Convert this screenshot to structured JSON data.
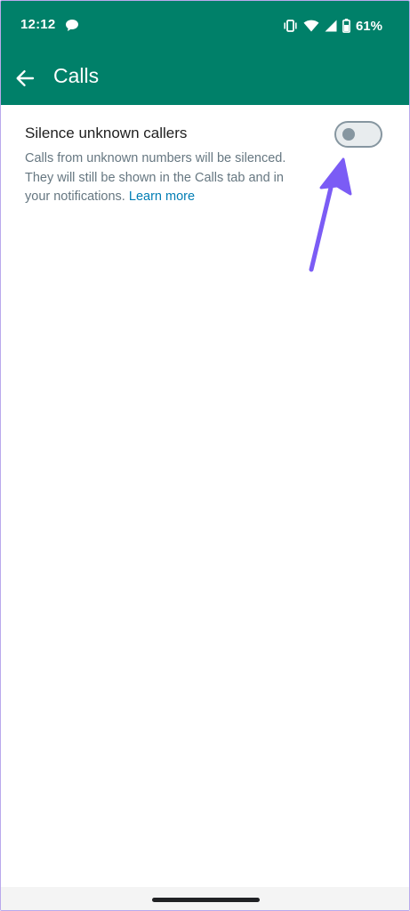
{
  "status_bar": {
    "time": "12:12",
    "battery_percent": "61%",
    "icons": [
      "chat-bubble-icon",
      "vibrate-icon",
      "wifi-icon",
      "cellular-signal-icon",
      "battery-icon"
    ]
  },
  "app_bar": {
    "title": "Calls",
    "background": "#008069"
  },
  "setting": {
    "title": "Silence unknown callers",
    "description": "Calls from unknown numbers will be silenced. They will still be shown in the Calls tab and in your notifications.",
    "learn_more": "Learn more",
    "toggle_on": false
  },
  "annotation": {
    "arrow_color": "#7b5cf5"
  }
}
